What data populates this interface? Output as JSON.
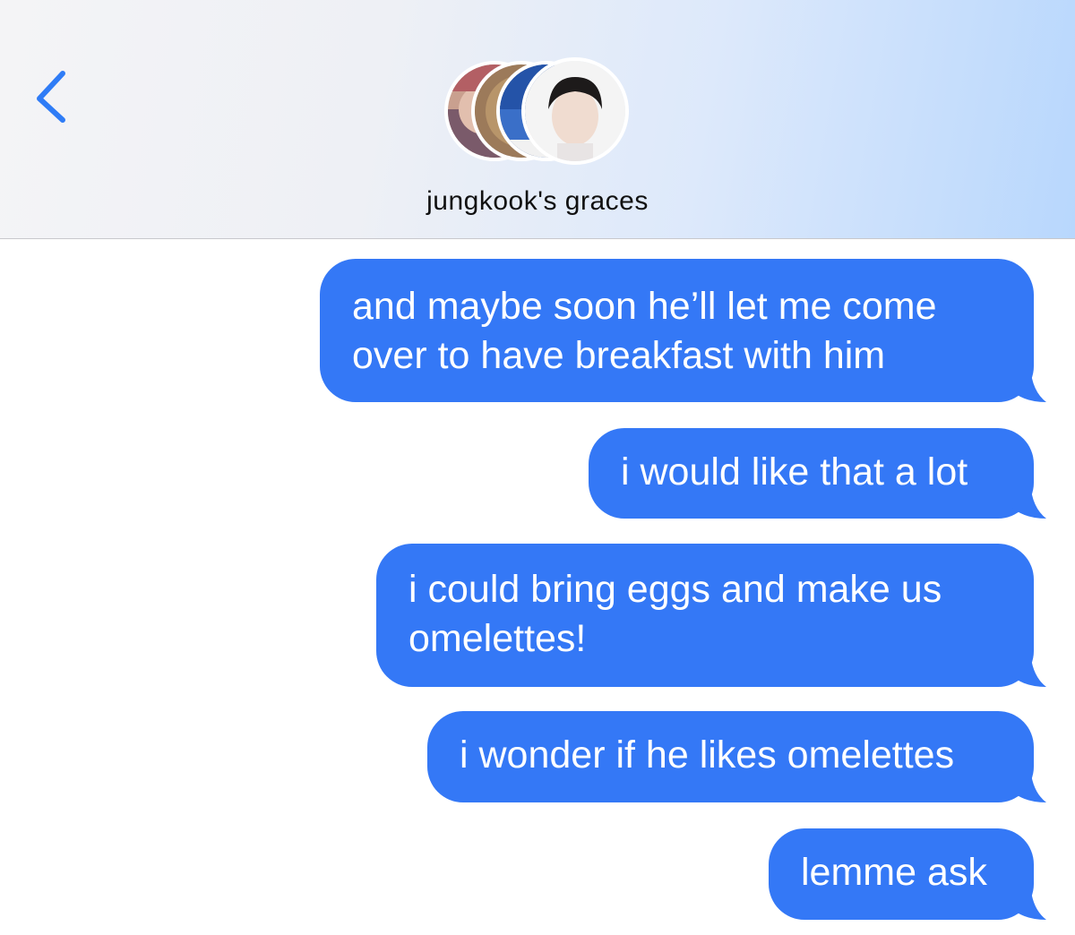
{
  "header": {
    "back_icon": "chevron-left-icon",
    "group_name": "jungkook's graces",
    "avatars": [
      "avatar-1",
      "avatar-2",
      "avatar-3",
      "avatar-4"
    ]
  },
  "messages": [
    {
      "line1": "and maybe soon he’ll let me come",
      "line2": "over to have breakfast with him"
    },
    {
      "line1": "i would like that a lot"
    },
    {
      "line1": "i could bring eggs and make us",
      "line2": "omelettes!"
    },
    {
      "line1": "i wonder if he likes omelettes"
    },
    {
      "line1": "lemme ask"
    }
  ],
  "colors": {
    "bubble": "#3478f6",
    "accent": "#2f7cf6",
    "text_on_bubble": "#ffffff"
  }
}
